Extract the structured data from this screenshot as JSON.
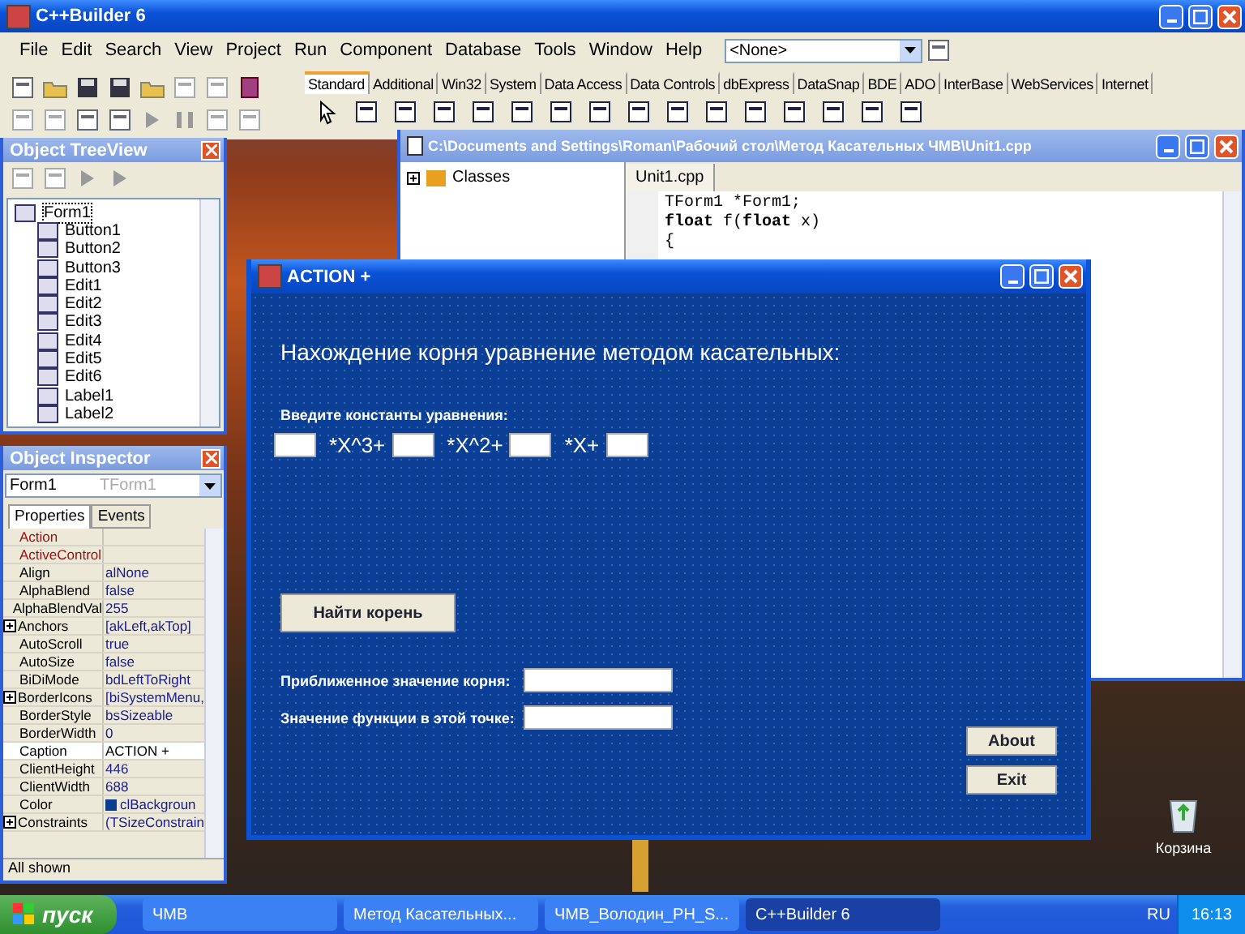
{
  "ide": {
    "title": "C++Builder 6",
    "menu": [
      "File",
      "Edit",
      "Search",
      "View",
      "Project",
      "Run",
      "Component",
      "Database",
      "Tools",
      "Window",
      "Help"
    ],
    "config_combo": "<None>",
    "palette_tabs": [
      {
        "label": "Standard",
        "selected": true
      },
      {
        "label": "Additional",
        "selected": false
      },
      {
        "label": "Win32",
        "selected": false
      },
      {
        "label": "System",
        "selected": false
      },
      {
        "label": "Data Access",
        "selected": false
      },
      {
        "label": "Data Controls",
        "selected": false
      },
      {
        "label": "dbExpress",
        "selected": false
      },
      {
        "label": "DataSnap",
        "selected": false
      },
      {
        "label": "BDE",
        "selected": false
      },
      {
        "label": "ADO",
        "selected": false
      },
      {
        "label": "InterBase",
        "selected": false
      },
      {
        "label": "WebServices",
        "selected": false
      },
      {
        "label": "Internet",
        "selected": false
      }
    ]
  },
  "tree_view": {
    "title": "Object TreeView",
    "root": {
      "label": "Form1",
      "expanded": true,
      "children": [
        {
          "label": "Button1"
        },
        {
          "label": "Button2"
        },
        {
          "label": "Button3"
        },
        {
          "label": "Edit1"
        },
        {
          "label": "Edit2"
        },
        {
          "label": "Edit3"
        },
        {
          "label": "Edit4"
        },
        {
          "label": "Edit5"
        },
        {
          "label": "Edit6"
        },
        {
          "label": "Label1"
        },
        {
          "label": "Label2"
        }
      ]
    }
  },
  "inspector": {
    "title": "Object Inspector",
    "object": "Form1",
    "object_type": "TForm1",
    "tabs": [
      {
        "label": "Properties",
        "selected": true
      },
      {
        "label": "Events",
        "selected": false
      }
    ],
    "rows": [
      {
        "name": "Action",
        "value": "",
        "kind": "link",
        "expandable": false,
        "selected": false
      },
      {
        "name": "ActiveControl",
        "value": "",
        "kind": "link",
        "expandable": false,
        "selected": false
      },
      {
        "name": "Align",
        "value": "alNone",
        "kind": "plain",
        "expandable": false,
        "selected": false
      },
      {
        "name": "AlphaBlend",
        "value": "false",
        "kind": "plain",
        "expandable": false,
        "selected": false
      },
      {
        "name": "AlphaBlendVal",
        "value": "255",
        "kind": "plain",
        "expandable": false,
        "selected": false
      },
      {
        "name": "Anchors",
        "value": "[akLeft,akTop]",
        "kind": "plain",
        "expandable": true,
        "selected": false
      },
      {
        "name": "AutoScroll",
        "value": "true",
        "kind": "plain",
        "expandable": false,
        "selected": false
      },
      {
        "name": "AutoSize",
        "value": "false",
        "kind": "plain",
        "expandable": false,
        "selected": false
      },
      {
        "name": "BiDiMode",
        "value": "bdLeftToRight",
        "kind": "plain",
        "expandable": false,
        "selected": false
      },
      {
        "name": "BorderIcons",
        "value": "[biSystemMenu,",
        "kind": "plain",
        "expandable": true,
        "selected": false
      },
      {
        "name": "BorderStyle",
        "value": "bsSizeable",
        "kind": "plain",
        "expandable": false,
        "selected": false
      },
      {
        "name": "BorderWidth",
        "value": "0",
        "kind": "plain",
        "expandable": false,
        "selected": false
      },
      {
        "name": "Caption",
        "value": "ACTION +",
        "kind": "plain",
        "expandable": false,
        "selected": true
      },
      {
        "name": "ClientHeight",
        "value": "446",
        "kind": "plain",
        "expandable": false,
        "selected": false
      },
      {
        "name": "ClientWidth",
        "value": "688",
        "kind": "plain",
        "expandable": false,
        "selected": false
      },
      {
        "name": "Color",
        "value": "clBackgroun",
        "kind": "plain",
        "expandable": false,
        "selected": false,
        "color": "#0a3d91"
      },
      {
        "name": "Constraints",
        "value": "(TSizeConstrain",
        "kind": "plain",
        "expandable": true,
        "selected": false
      }
    ],
    "status": "All shown"
  },
  "editor": {
    "title": "C:\\Documents and Settings\\Roman\\Рабочий стол\\Метод Касательных ЧМВ\\Unit1.cpp",
    "class_tree": "Classes",
    "tab": "Unit1.cpp",
    "code": [
      "TForm1 *Form1;",
      "**float** f(**float** x)",
      "{"
    ]
  },
  "form": {
    "title": "ACTION +",
    "heading": "Нахождение корня уравнение методом касательных:",
    "prompt": "Введите константы уравнения:",
    "equation": [
      {
        "kind": "field"
      },
      {
        "kind": "text",
        "text": "*X^3+"
      },
      {
        "kind": "field"
      },
      {
        "kind": "text",
        "text": "*X^2+"
      },
      {
        "kind": "field"
      },
      {
        "kind": "text",
        "text": "*X+"
      },
      {
        "kind": "field"
      }
    ],
    "find_button": "Найти корень",
    "results": [
      {
        "label": "Приближенное значение корня:"
      },
      {
        "label": "Значение функции в этой точке:"
      }
    ],
    "buttons": [
      "About",
      "Exit"
    ]
  },
  "desktop": {
    "icons": [
      {
        "label": "Корзина"
      }
    ]
  },
  "taskbar": {
    "start": "пуск",
    "items": [
      {
        "label": "ЧМВ",
        "selected": false
      },
      {
        "label": "Метод Касательных...",
        "selected": false
      },
      {
        "label": "ЧМВ_Володин_PH_S...",
        "selected": false
      },
      {
        "label": "C++Builder 6",
        "selected": true
      }
    ],
    "language": "RU",
    "clock": "16:13"
  }
}
